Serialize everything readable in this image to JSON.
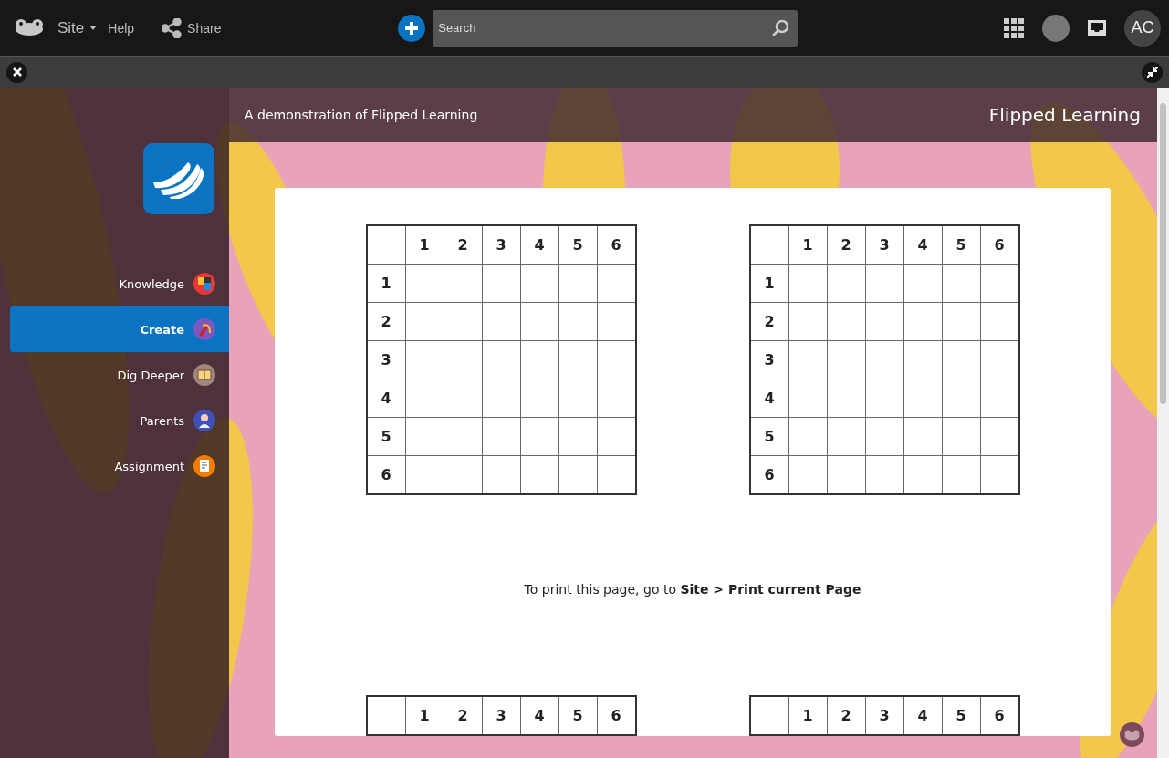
{
  "topbar": {
    "site_menu": "Site",
    "help": "Help",
    "share": "Share",
    "search": {
      "placeholder": "Search"
    },
    "avatar_initials": "AC"
  },
  "sidebar": {
    "items": [
      {
        "label": "Knowledge",
        "selected": false,
        "color": "#e53935"
      },
      {
        "label": "Create",
        "selected": true,
        "color": "#7e57c2"
      },
      {
        "label": "Dig Deeper",
        "selected": false,
        "color": "#a1887f"
      },
      {
        "label": "Parents",
        "selected": false,
        "color": "#3f51b5"
      },
      {
        "label": "Assignment",
        "selected": false,
        "color": "#f57c00"
      }
    ]
  },
  "page": {
    "subtitle": "A demonstration of Flipped Learning",
    "title": "Flipped Learning",
    "top_grids": [
      {
        "column_headers": [
          "1",
          "2",
          "3",
          "4",
          "5",
          "6"
        ],
        "row_labels": [
          "1",
          "2",
          "3",
          "4",
          "5",
          "6"
        ]
      },
      {
        "column_headers": [
          "1",
          "2",
          "3",
          "4",
          "5",
          "6"
        ],
        "row_labels": [
          "1",
          "2",
          "3",
          "4",
          "5",
          "6"
        ]
      }
    ],
    "print_note": "To print this page, go to **Site > Print current Page**",
    "bottom_grids": [
      {
        "column_headers": [
          "1",
          "2",
          "3",
          "4",
          "5",
          "6"
        ]
      },
      {
        "column_headers": [
          "1",
          "2",
          "3",
          "4",
          "5",
          "6"
        ]
      }
    ]
  }
}
